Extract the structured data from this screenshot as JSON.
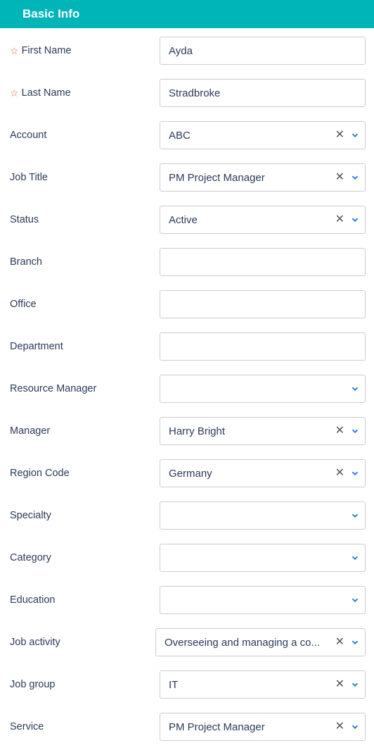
{
  "header": {
    "title": "Basic Info"
  },
  "fields": [
    {
      "label": "First Name",
      "value": "Ayda",
      "required": true,
      "type": "text"
    },
    {
      "label": "Last Name",
      "value": "Stradbroke",
      "required": true,
      "type": "text"
    },
    {
      "label": "Account",
      "value": "ABC",
      "required": false,
      "type": "select",
      "clearable": true
    },
    {
      "label": "Job Title",
      "value": "PM Project Manager",
      "required": false,
      "type": "select",
      "clearable": true
    },
    {
      "label": "Status",
      "value": "Active",
      "required": false,
      "type": "select",
      "clearable": true
    },
    {
      "label": "Branch",
      "value": "",
      "required": false,
      "type": "text"
    },
    {
      "label": "Office",
      "value": "",
      "required": false,
      "type": "text"
    },
    {
      "label": "Department",
      "value": "",
      "required": false,
      "type": "text"
    },
    {
      "label": "Resource Manager",
      "value": "",
      "required": false,
      "type": "select",
      "clearable": false
    },
    {
      "label": "Manager",
      "value": "Harry Bright",
      "required": false,
      "type": "select",
      "clearable": true
    },
    {
      "label": "Region Code",
      "value": "Germany",
      "required": false,
      "type": "select",
      "clearable": true
    },
    {
      "label": "Specialty",
      "value": "",
      "required": false,
      "type": "select",
      "clearable": false
    },
    {
      "label": "Category",
      "value": "",
      "required": false,
      "type": "select",
      "clearable": false
    },
    {
      "label": "Education",
      "value": "",
      "required": false,
      "type": "select",
      "clearable": false
    },
    {
      "label": "Job activity",
      "value": "Overseeing and managing a co...",
      "required": false,
      "type": "select",
      "clearable": true
    },
    {
      "label": "Job group",
      "value": "IT",
      "required": false,
      "type": "select",
      "clearable": true
    },
    {
      "label": "Service",
      "value": "PM Project Manager",
      "required": false,
      "type": "select",
      "clearable": true
    }
  ]
}
